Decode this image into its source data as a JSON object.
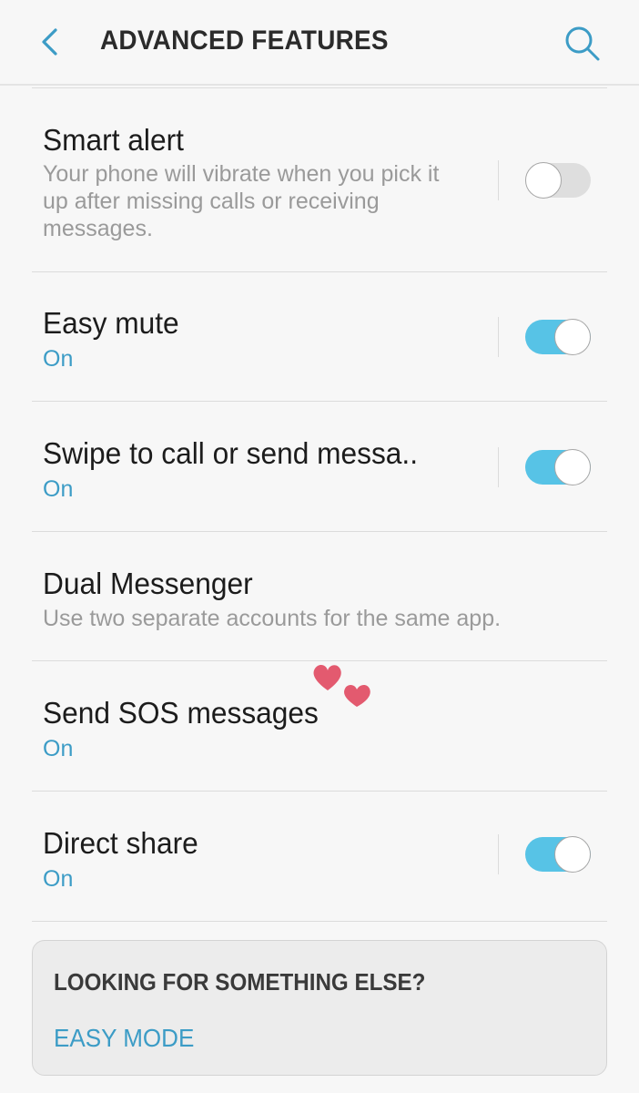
{
  "header": {
    "title": "ADVANCED FEATURES",
    "back_icon": "chevron-left-icon",
    "search_icon": "search-icon"
  },
  "settings": [
    {
      "title": "Smart alert",
      "subtitle": "Your phone will vibrate when you pick it up after missing calls or receiving messages.",
      "toggle": "off"
    },
    {
      "title": "Easy mute",
      "status": "On",
      "toggle": "on"
    },
    {
      "title": "Swipe to call or send messa..",
      "status": "On",
      "toggle": "on"
    },
    {
      "title": "Dual Messenger",
      "subtitle": "Use two separate accounts for the same app."
    },
    {
      "title": "Send SOS messages",
      "status": "On"
    },
    {
      "title": "Direct share",
      "status": "On",
      "toggle": "on"
    }
  ],
  "suggestion_card": {
    "heading": "LOOKING FOR SOMETHING ELSE?",
    "link": "EASY MODE"
  },
  "decoration": {
    "icon": "hearts-sticker-icon",
    "color": "#e35a6f"
  },
  "colors": {
    "accent": "#3c9cc6",
    "toggle_on": "#57c3e6",
    "toggle_off": "#dedede",
    "background": "#f7f7f7"
  }
}
